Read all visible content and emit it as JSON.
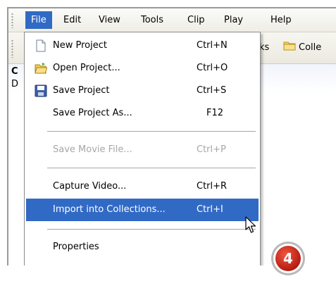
{
  "menubar": {
    "items": [
      {
        "label": "File"
      },
      {
        "label": "Edit"
      },
      {
        "label": "View"
      },
      {
        "label": "Tools"
      },
      {
        "label": "Clip"
      },
      {
        "label": "Play"
      },
      {
        "label": "Help"
      }
    ]
  },
  "toolbar": {
    "partial_tasks": "ks",
    "partial_collections": "Colle"
  },
  "panel": {
    "title_partial": "C",
    "subtitle_partial": "D"
  },
  "file_menu": {
    "items": [
      {
        "label": "New Project",
        "shortcut": "Ctrl+N",
        "icon": "new-document-icon"
      },
      {
        "label": "Open Project...",
        "shortcut": "Ctrl+O",
        "icon": "open-folder-icon"
      },
      {
        "label": "Save Project",
        "shortcut": "Ctrl+S",
        "icon": "floppy-disk-icon"
      },
      {
        "label": "Save Project As...",
        "shortcut": "F12"
      },
      {
        "label": "Save Movie File...",
        "shortcut": "Ctrl+P",
        "disabled": true
      },
      {
        "label": "Capture Video...",
        "shortcut": "Ctrl+R"
      },
      {
        "label": "Import into Collections...",
        "shortcut": "Ctrl+I",
        "highlighted": true
      },
      {
        "label": "Properties"
      }
    ]
  },
  "step_badge": "4",
  "colors": {
    "highlight": "#316ac5",
    "badge_red": "#d42a1c",
    "disabled_text": "#a7a6aa"
  }
}
